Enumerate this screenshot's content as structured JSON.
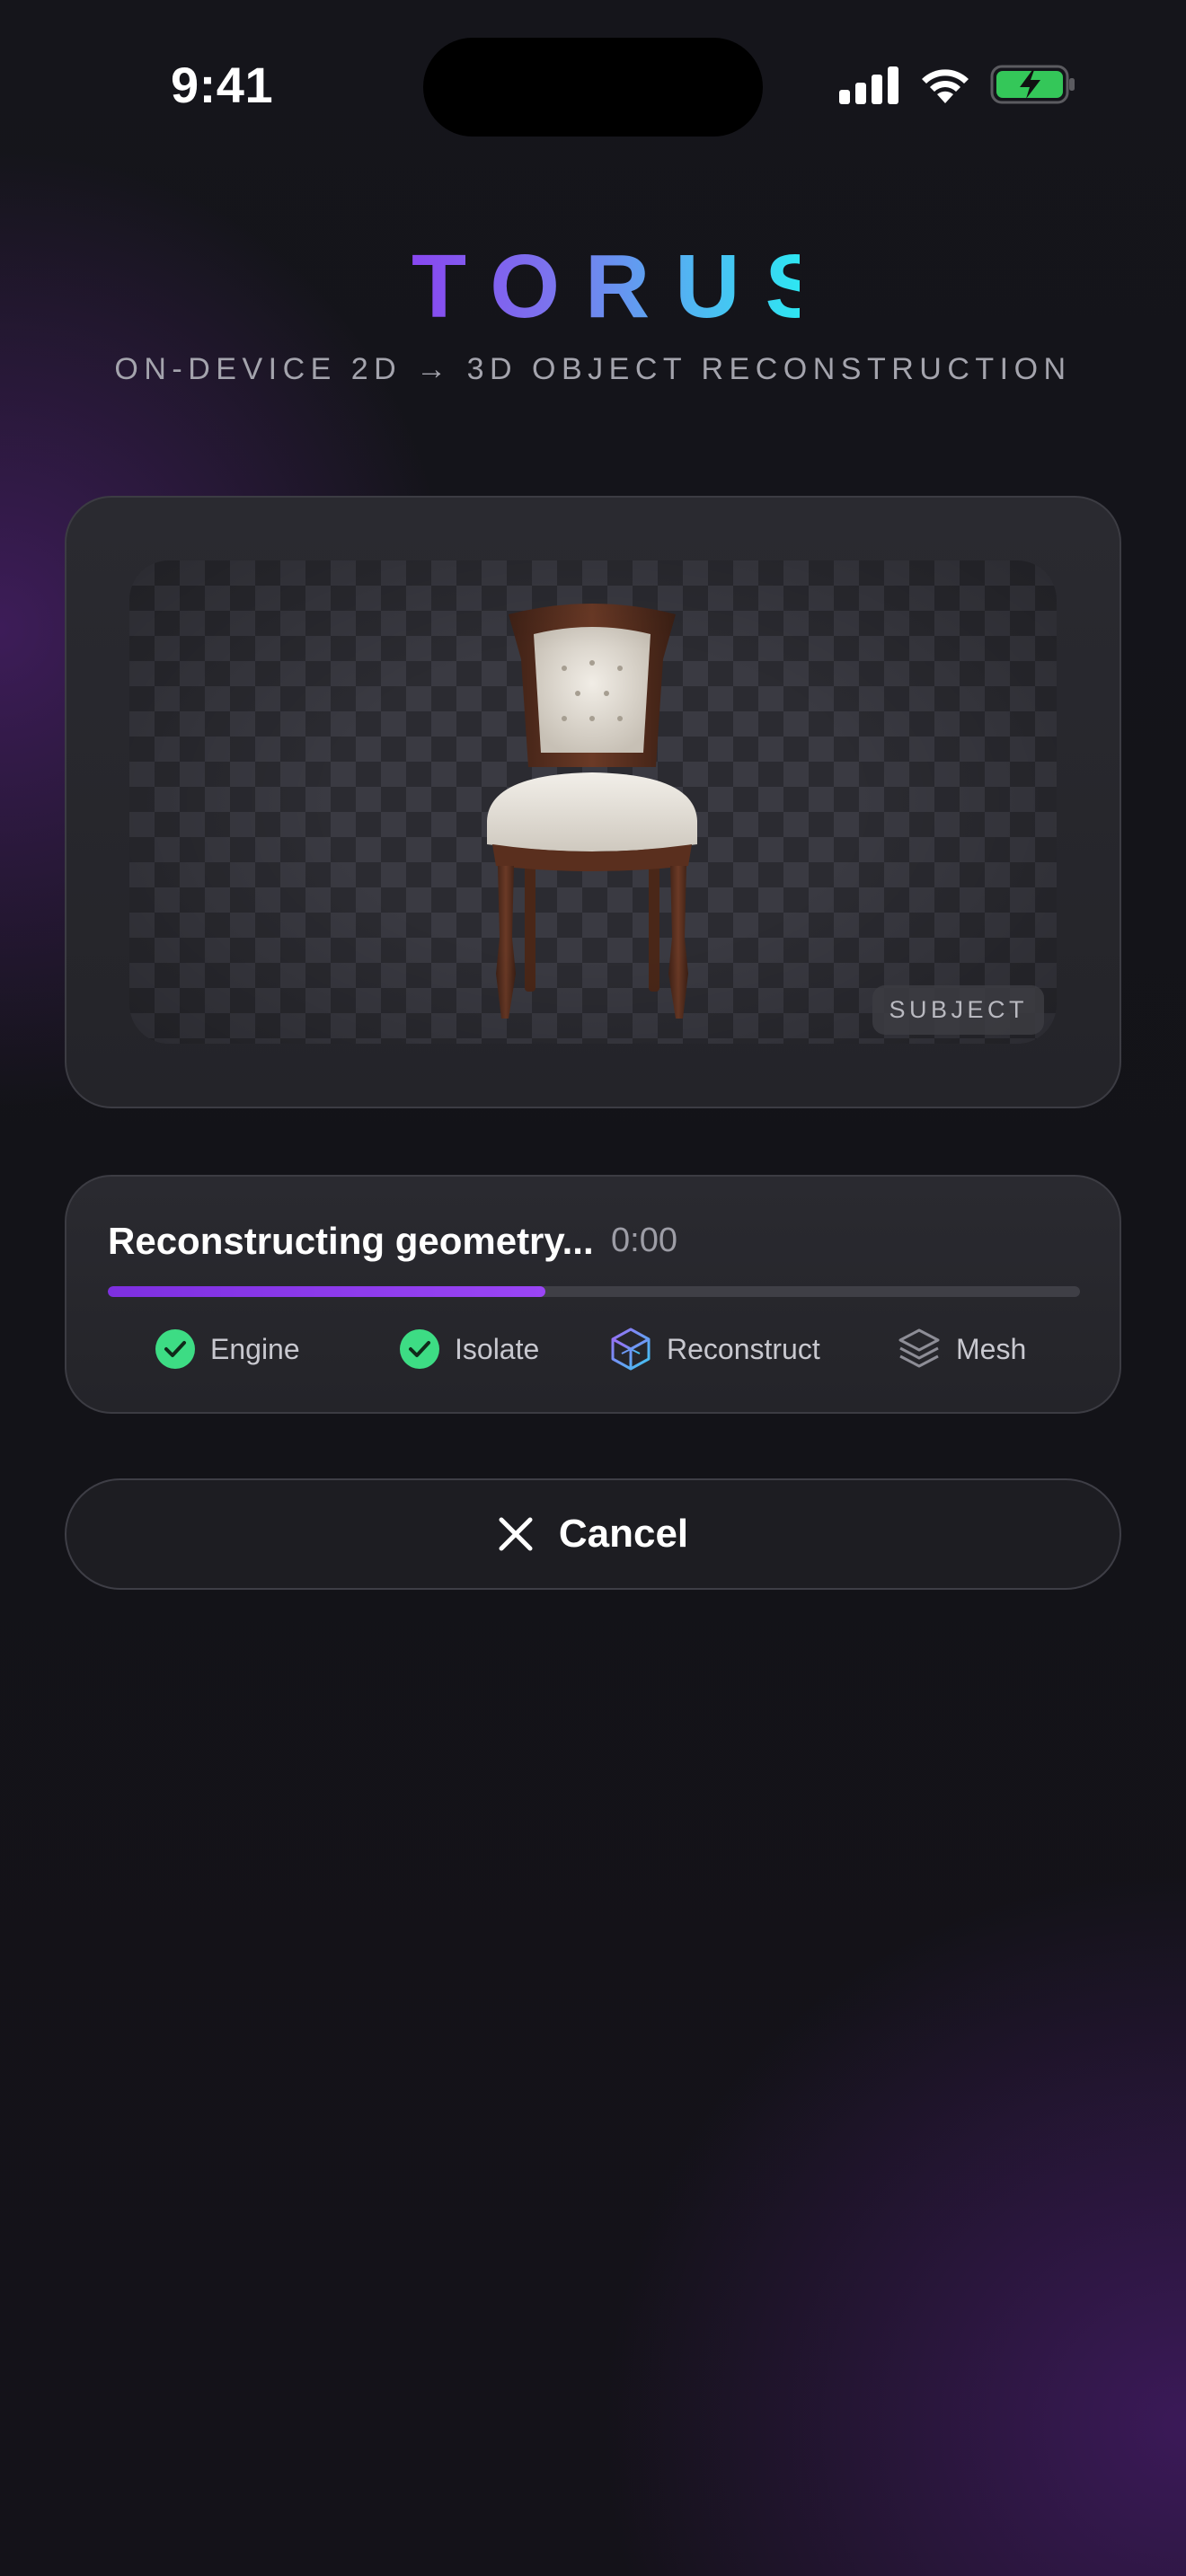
{
  "status_bar": {
    "time": "9:41",
    "icons": [
      "cellular-signal-icon",
      "wifi-icon",
      "battery-charging-icon"
    ],
    "battery_color": "#34c759"
  },
  "header": {
    "brand": "TORUS",
    "tagline": "ON-DEVICE 2D → 3D OBJECT RECONSTRUCTION",
    "brand_gradient": [
      "#8a3ff0",
      "#2ee6f2"
    ]
  },
  "image_card": {
    "badge": "SUBJECT",
    "subject_icon": "chair-image"
  },
  "progress": {
    "title": "Reconstructing geometry...",
    "elapsed": "0:00",
    "fraction": 0.45,
    "accent": "#8a3ff0",
    "steps": [
      {
        "label": "Engine",
        "state": "done",
        "icon": "check-circle-icon"
      },
      {
        "label": "Isolate",
        "state": "done",
        "icon": "check-circle-icon"
      },
      {
        "label": "Reconstruct",
        "state": "active",
        "icon": "cube-icon"
      },
      {
        "label": "Mesh",
        "state": "pending",
        "icon": "layers-icon"
      }
    ],
    "done_color": "#3ddc84"
  },
  "cancel": {
    "label": "Cancel",
    "icon": "close-icon"
  }
}
